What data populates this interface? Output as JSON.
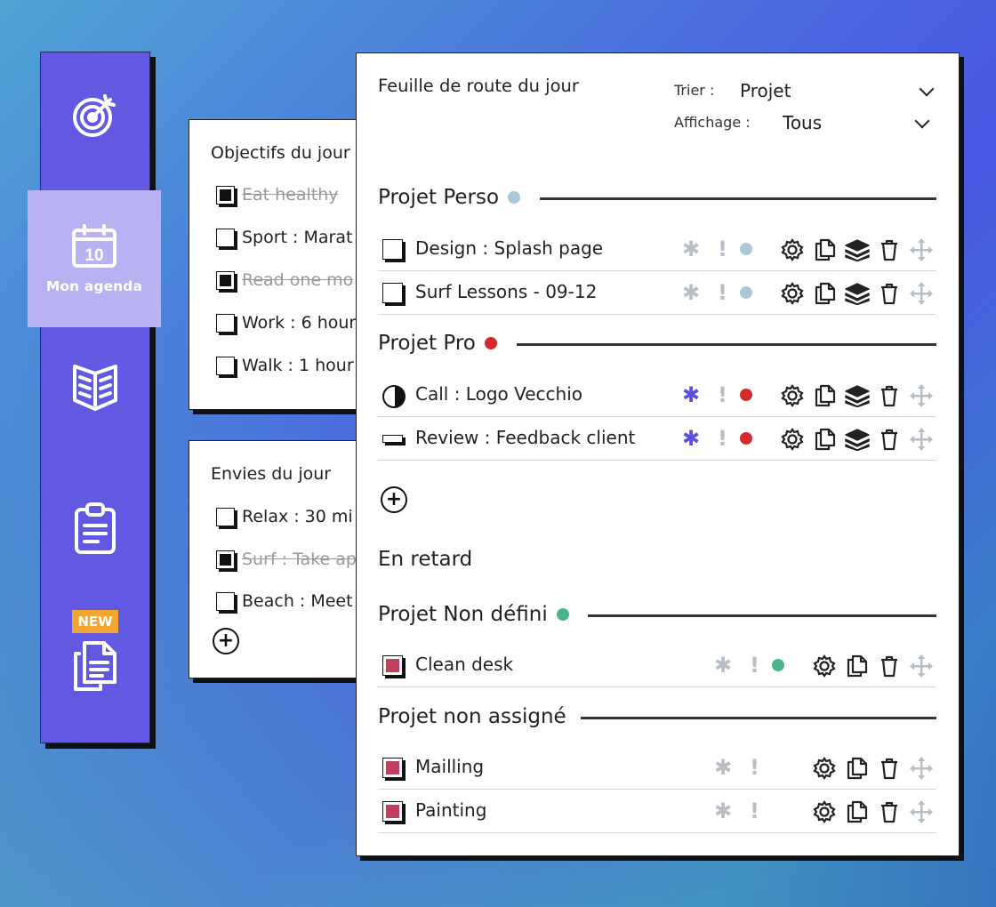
{
  "sidebar": {
    "items": [
      {
        "icon": "target-icon"
      },
      {
        "icon": "calendar-icon",
        "day": "10",
        "label": "Mon agenda",
        "active": true
      },
      {
        "icon": "book-icon"
      },
      {
        "icon": "clipboard-icon"
      },
      {
        "icon": "documents-icon",
        "badge": "NEW"
      }
    ]
  },
  "objectives": {
    "title": "Objectifs du jour",
    "items": [
      {
        "label": "Eat healthy",
        "done": true
      },
      {
        "label": "Sport : Marat",
        "done": false
      },
      {
        "label": "Read one mo",
        "done": true
      },
      {
        "label": "Work : 6 hour",
        "done": false
      },
      {
        "label": "Walk : 1 hour",
        "done": false
      }
    ]
  },
  "wishes": {
    "title": "Envies du jour",
    "items": [
      {
        "label": "Relax : 30 mi",
        "done": false
      },
      {
        "label": "Surf : Take ap",
        "done": true
      },
      {
        "label": "Beach : Meet",
        "done": false
      }
    ],
    "add_icon": "plus-circle-icon"
  },
  "roadmap": {
    "title": "Feuille de route du jour",
    "sort_label": "Trier :",
    "sort_value": "Projet",
    "display_label": "Affichage :",
    "display_value": "Tous",
    "projects": [
      {
        "label": "Projet  Perso",
        "color": "#a8c8d8",
        "tasks": [
          {
            "label": "Design : Splash page",
            "status": "empty"
          },
          {
            "label": "Surf Lessons - 09-12",
            "status": "empty"
          }
        ]
      },
      {
        "label": "Projet  Pro",
        "color": "#d42a2a",
        "tasks": [
          {
            "label": "Call : Logo Vecchio",
            "status": "half-moon"
          },
          {
            "label": "Review : Feedback client",
            "status": "bar"
          }
        ]
      }
    ],
    "late_section": "En retard",
    "late_projects": [
      {
        "label": "Projet  Non défini",
        "color": "#4bb38a",
        "tasks": [
          {
            "label": "Clean desk",
            "status": "late"
          }
        ]
      },
      {
        "label": "Projet non assigné",
        "color": "",
        "tasks": [
          {
            "label": "Mailling",
            "status": "late"
          },
          {
            "label": "Painting",
            "status": "late"
          }
        ]
      }
    ],
    "colors": {
      "star_active": "#5a4fe0",
      "star_inactive": "#b8bec6",
      "late_checkbox": "#c0405e"
    }
  }
}
